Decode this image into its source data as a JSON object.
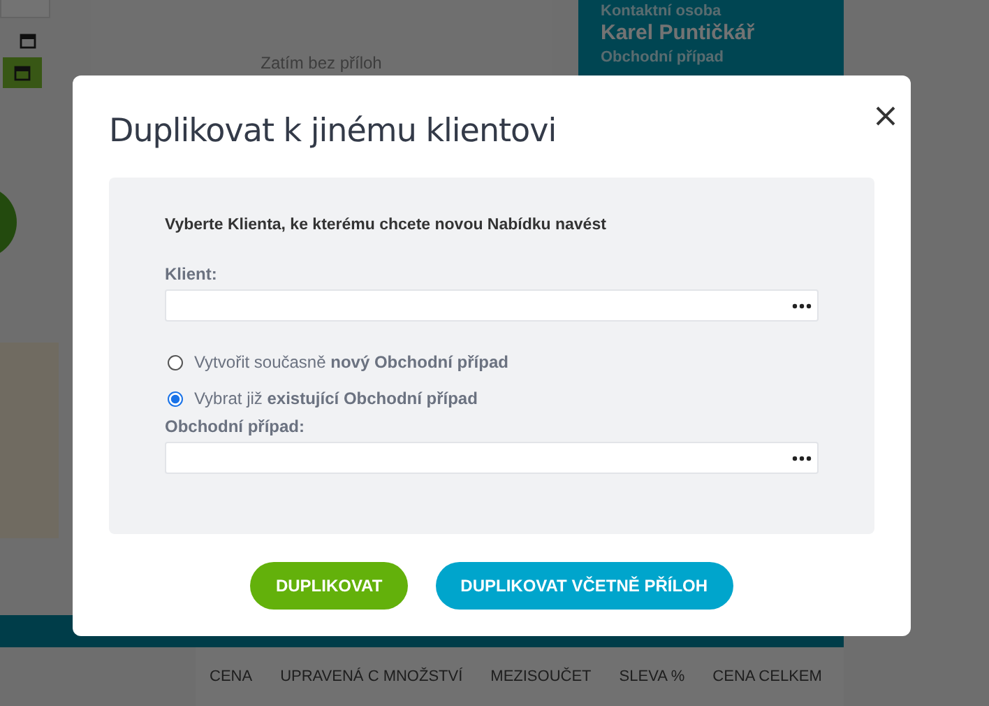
{
  "background": {
    "attachments_empty": "Zatím bez příloh",
    "contact_label": "Kontaktní osoba",
    "contact_name": "Karel Puntičkář",
    "case_label": "Obchodní případ",
    "columns": [
      "CENA",
      "UPRAVENÁ C MNOŽSTVÍ",
      "MEZISOUČET",
      "SLEVA %",
      "CENA CELKEM"
    ]
  },
  "dialog": {
    "title": "Duplikovat k jinému klientovi",
    "instruction": "Vyberte Klienta, ke kterému chcete novou Nabídku navést",
    "client_field": {
      "label": "Klient:"
    },
    "options": [
      {
        "label": "Vytvořit současně **nový Obchodní případ**",
        "selected": false
      },
      {
        "label": "Vybrat již **existující Obchodní případ**",
        "selected": true
      }
    ],
    "case_field": {
      "label": "Obchodní případ:"
    },
    "buttons": [
      {
        "label": "DUPLIKOVAT",
        "kind": "primary"
      },
      {
        "label": "DUPLIKOVAT VČETNĚ PŘÍLOH",
        "kind": "secondary"
      }
    ]
  }
}
